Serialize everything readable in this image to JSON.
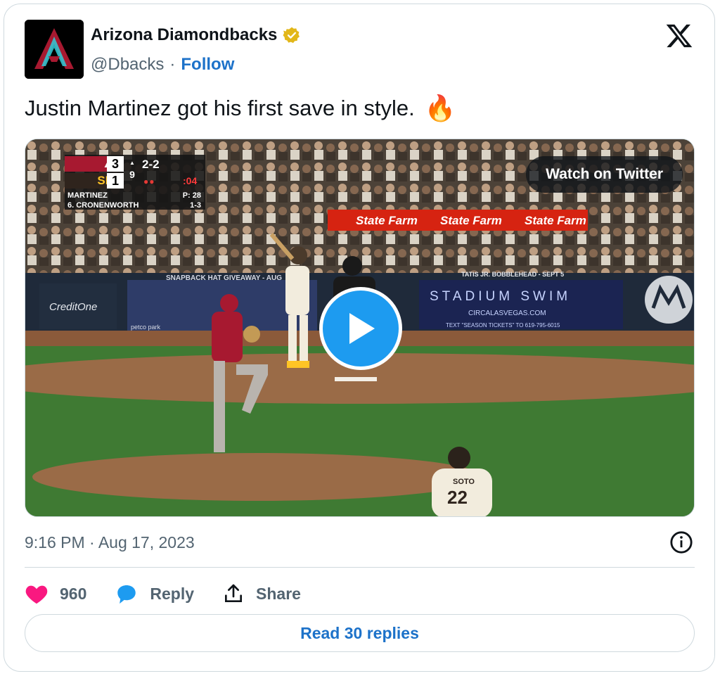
{
  "header": {
    "display_name": "Arizona Diamondbacks",
    "handle": "@Dbacks",
    "separator": "·",
    "follow_label": "Follow"
  },
  "tweet": {
    "text": "Justin Martinez got his first save in style.",
    "emoji": "🔥"
  },
  "media": {
    "watch_label": "Watch on Twitter",
    "scorebug": {
      "away_score": "3",
      "home_score": "1",
      "inning": "9",
      "count": "2-2",
      "clock": ":04",
      "pitcher": "MARTINEZ",
      "pitch_count": "P: 28",
      "batter": "6. CRONENWORTH",
      "batter_line": "1-3"
    },
    "signage": {
      "state_farm": "State Farm",
      "stadium_swim": "STADIUM SWIM",
      "circa_url": "CIRCALASVEGAS.COM",
      "season_tickets": "TEXT \"SEASON TICKETS\" TO 619-795-6015",
      "bobblehead": "TATIS JR. BOBBLEHEAD - SEPT 5",
      "hat_giveaway": "SNAPBACK HAT GIVEAWAY - AUG",
      "credit_one": "CreditOne",
      "petco": "petco park",
      "jersey_name": "SOTO",
      "jersey_number": "22"
    }
  },
  "footer": {
    "timestamp": "9:16 PM · Aug 17, 2023",
    "likes_count": "960",
    "reply_label": "Reply",
    "share_label": "Share",
    "read_replies_label": "Read 30 replies"
  },
  "colors": {
    "brand_blue": "#1d9bf0",
    "link_blue": "#1d72c9",
    "heart": "#f91880",
    "dbacks_red": "#a71930"
  }
}
